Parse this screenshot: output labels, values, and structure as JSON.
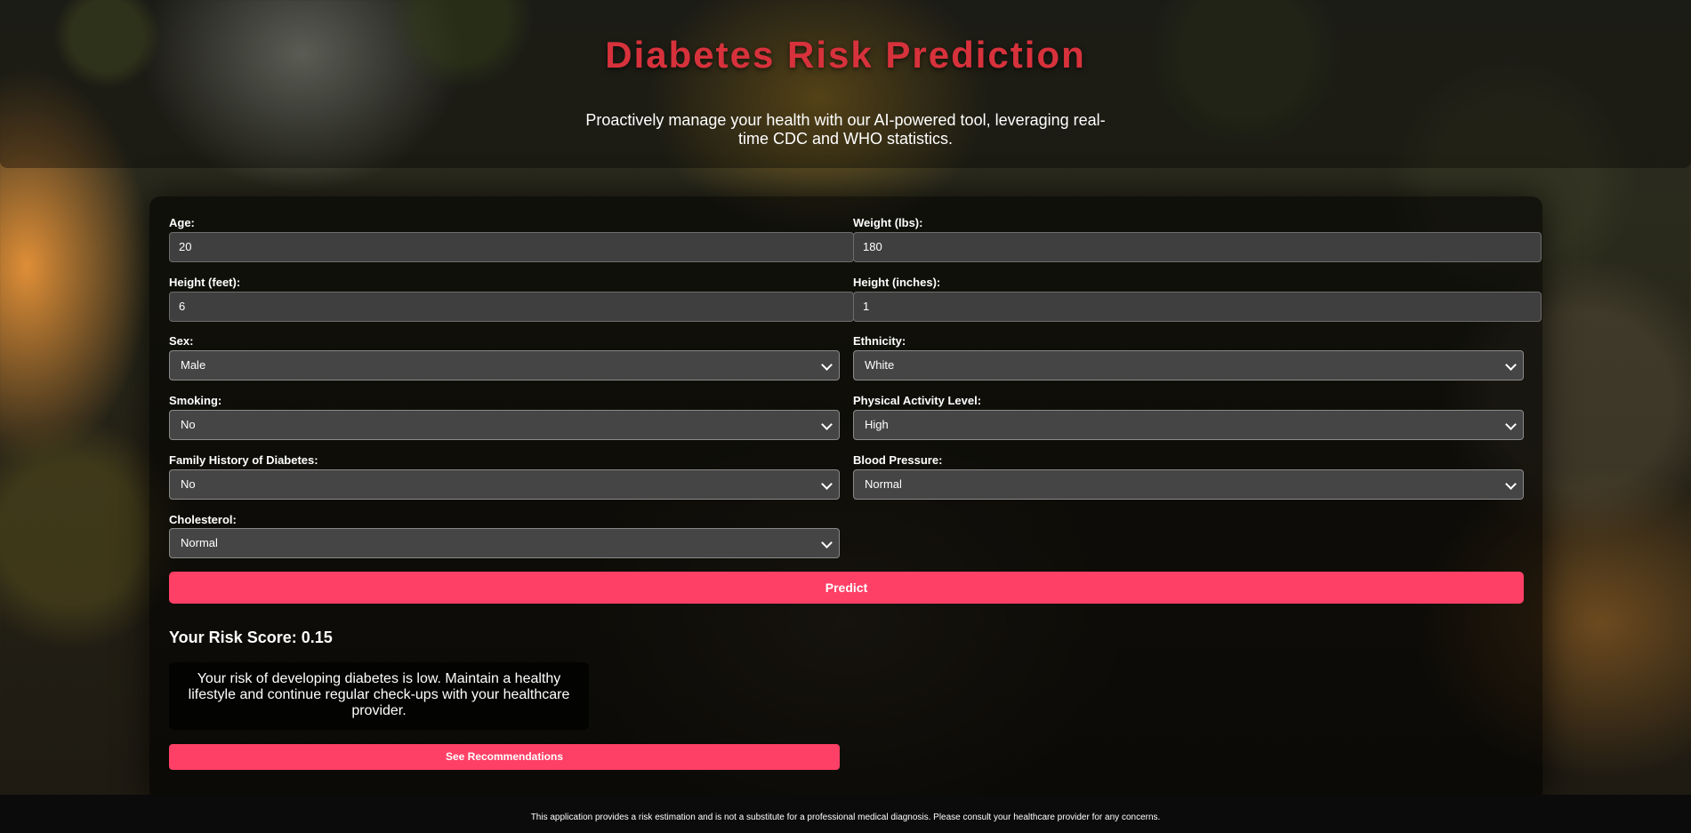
{
  "header": {
    "title": "Diabetes Risk Prediction",
    "subtitle": "Proactively manage your health with our AI-powered tool, leveraging real-time CDC and WHO statistics."
  },
  "form": {
    "age": {
      "label": "Age:",
      "value": "20"
    },
    "weight": {
      "label": "Weight (lbs):",
      "value": "180"
    },
    "height_feet": {
      "label": "Height (feet):",
      "value": "6"
    },
    "height_inches": {
      "label": "Height (inches):",
      "value": "1"
    },
    "sex": {
      "label": "Sex:",
      "value": "Male"
    },
    "ethnicity": {
      "label": "Ethnicity:",
      "value": "White"
    },
    "smoking": {
      "label": "Smoking:",
      "value": "No"
    },
    "activity": {
      "label": "Physical Activity Level:",
      "value": "High"
    },
    "family_history": {
      "label": "Family History of Diabetes:",
      "value": "No"
    },
    "blood_pressure": {
      "label": "Blood Pressure:",
      "value": "Normal"
    },
    "cholesterol": {
      "label": "Cholesterol:",
      "value": "Normal"
    },
    "predict_label": "Predict"
  },
  "result": {
    "score_text": "Your Risk Score: 0.15",
    "message": "Your risk of developing diabetes is low. Maintain a healthy lifestyle and continue regular check-ups with your healthcare provider.",
    "recommendations_label": "See Recommendations"
  },
  "footer": {
    "text": "This application provides a risk estimation and is not a substitute for a professional medical diagnosis. Please consult your healthcare provider for any concerns."
  },
  "colors": {
    "title": "#d7323c",
    "accent_button": "#ff4066"
  }
}
